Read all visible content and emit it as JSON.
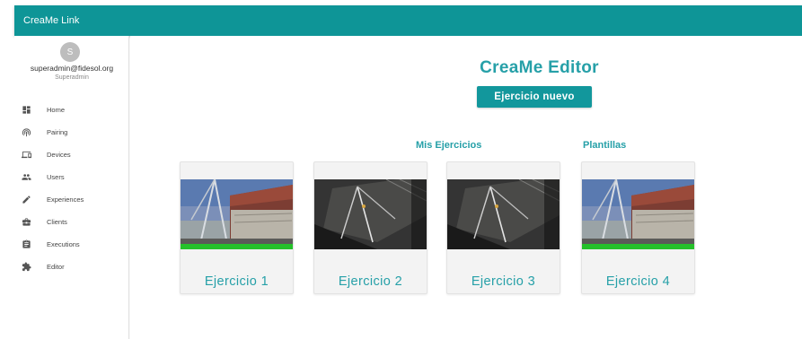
{
  "app": {
    "title": "CreaMe Link"
  },
  "user": {
    "avatar_initial": "S",
    "email": "superadmin@fidesol.org",
    "role": "Superadmin"
  },
  "sidebar": {
    "items": [
      {
        "label": "Home",
        "icon": "dashboard-icon"
      },
      {
        "label": "Pairing",
        "icon": "antenna-icon"
      },
      {
        "label": "Devices",
        "icon": "devices-icon"
      },
      {
        "label": "Users",
        "icon": "people-icon"
      },
      {
        "label": "Experiences",
        "icon": "pencil-icon"
      },
      {
        "label": "Clients",
        "icon": "briefcase-icon"
      },
      {
        "label": "Executions",
        "icon": "clipboard-icon"
      },
      {
        "label": "Editor",
        "icon": "puzzle-icon"
      }
    ]
  },
  "main": {
    "title": "CreaMe Editor",
    "new_button_label": "Ejercicio nuevo",
    "sections": {
      "mine_label": "Mis Ejercicios",
      "templates_label": "Plantillas"
    },
    "cards": [
      {
        "title": "Ejercicio 1",
        "thumbnail": "building-scene"
      },
      {
        "title": "Ejercicio 2",
        "thumbnail": "ground-scene"
      },
      {
        "title": "Ejercicio 3",
        "thumbnail": "ground-scene"
      },
      {
        "title": "Ejercicio 4",
        "thumbnail": "building-scene"
      }
    ]
  },
  "colors": {
    "primary": "#0e9597",
    "accent_text": "#26a0a8",
    "button": "#12979c"
  }
}
